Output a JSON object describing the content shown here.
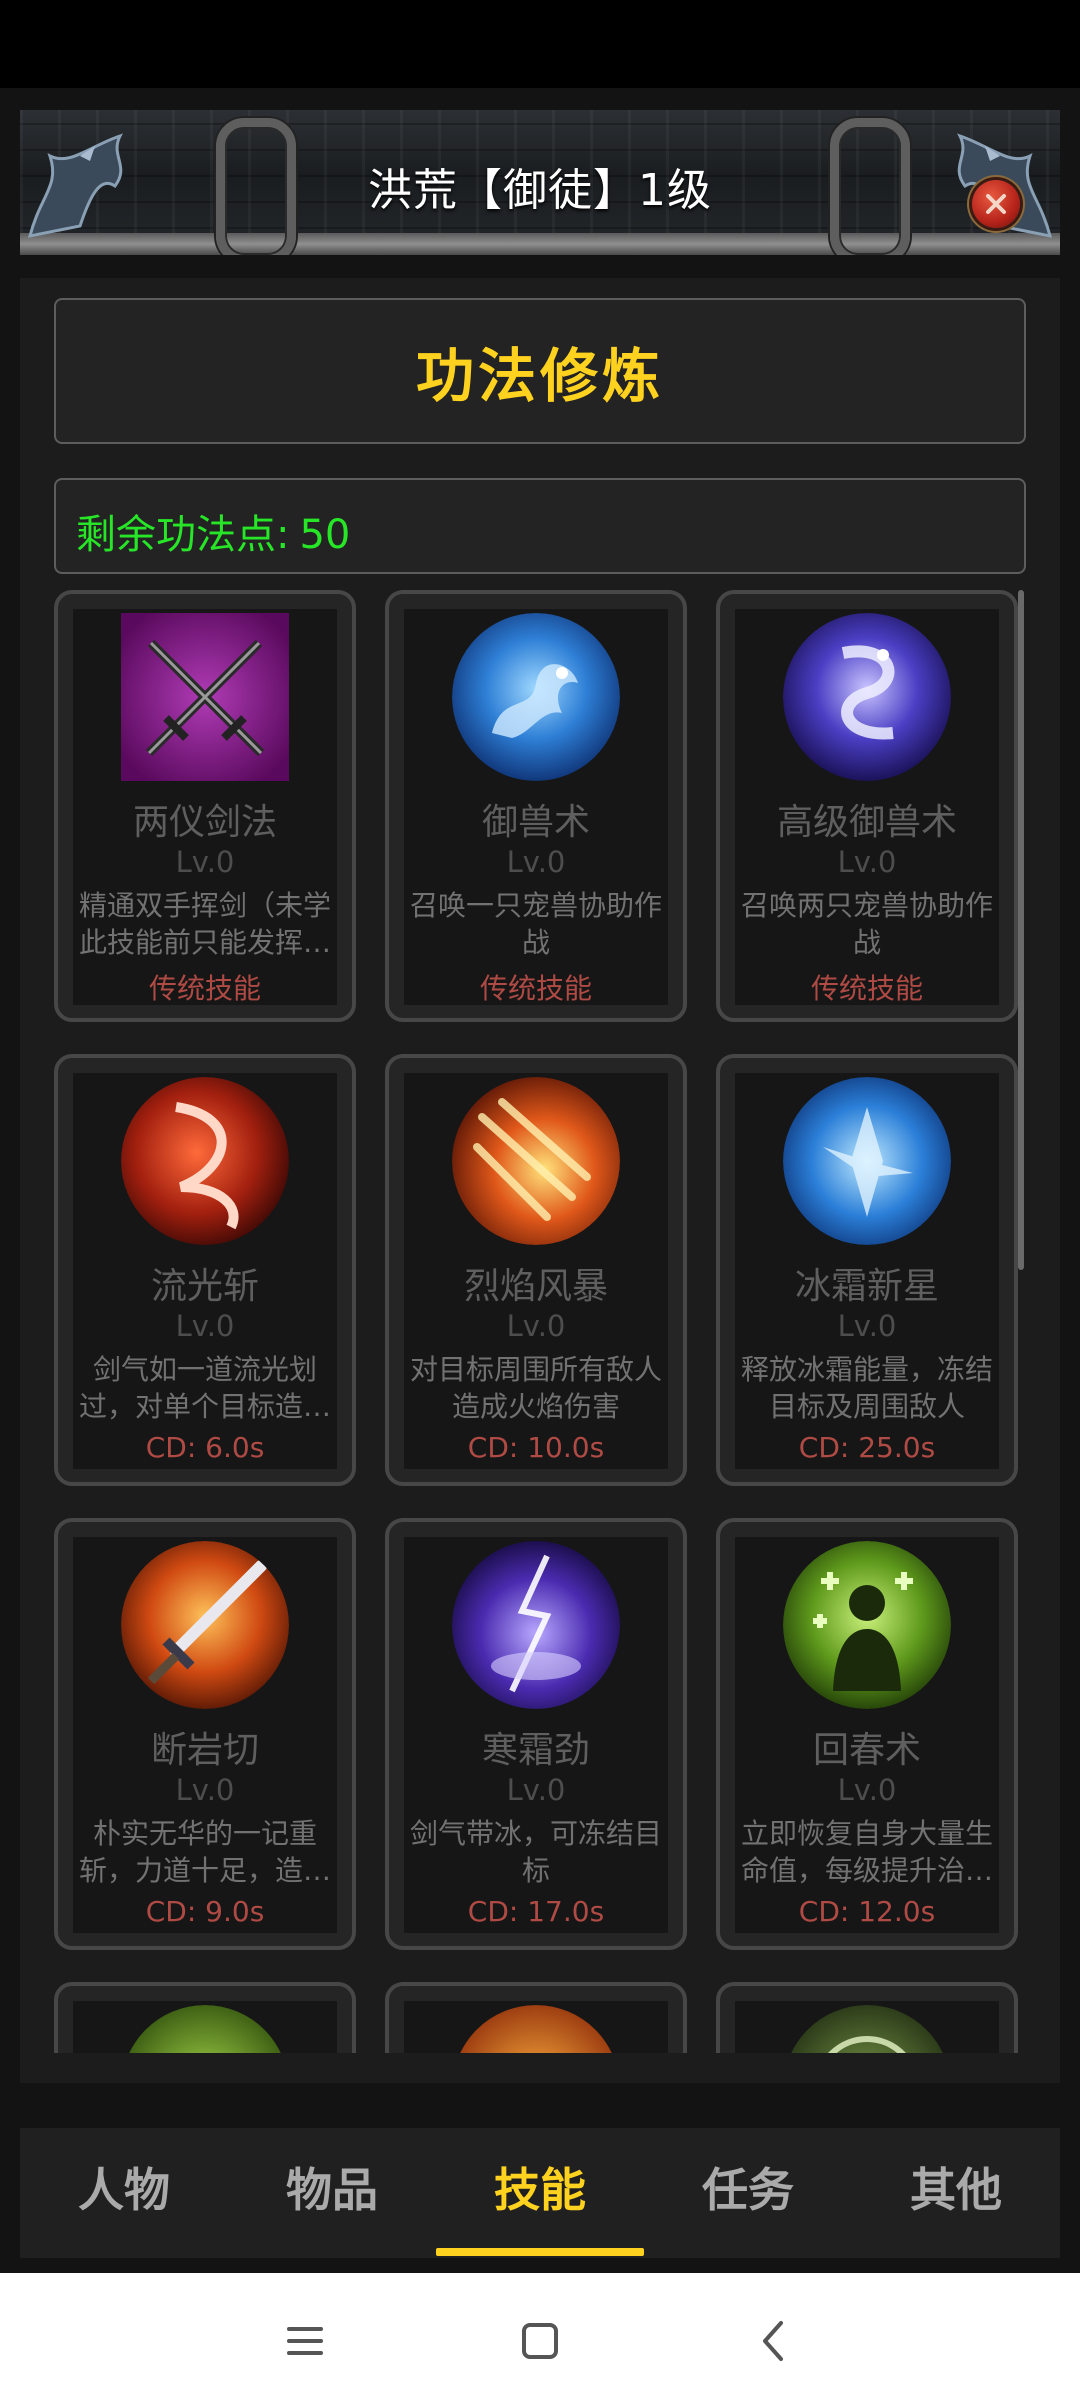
{
  "header": {
    "title": "洪荒【御徒】1级"
  },
  "panel": {
    "title": "功法修炼",
    "points_label": "剩余功法点:",
    "points_value": "50"
  },
  "skills": [
    {
      "name": "两仪剑法",
      "level": "Lv.0",
      "desc": "精通双手挥剑（未学此技能前只能发挥…",
      "tag": "传统技能",
      "icon": "crossed-swords-icon"
    },
    {
      "name": "御兽术",
      "level": "Lv.0",
      "desc": "召唤一只宠兽协助作战",
      "tag": "传统技能",
      "icon": "blue-dragon-icon"
    },
    {
      "name": "高级御兽术",
      "level": "Lv.0",
      "desc": "召唤两只宠兽协助作战",
      "tag": "传统技能",
      "icon": "purple-dragon-icon"
    },
    {
      "name": "流光斩",
      "level": "Lv.0",
      "desc": "剑气如一道流光划过，对单个目标造…",
      "tag": "CD: 6.0s",
      "icon": "light-slash-icon"
    },
    {
      "name": "烈焰风暴",
      "level": "Lv.0",
      "desc": "对目标周围所有敌人造成火焰伤害",
      "tag": "CD: 10.0s",
      "icon": "fire-storm-icon"
    },
    {
      "name": "冰霜新星",
      "level": "Lv.0",
      "desc": "释放冰霜能量，冻结目标及周围敌人",
      "tag": "CD: 25.0s",
      "icon": "frost-nova-icon"
    },
    {
      "name": "断岩切",
      "level": "Lv.0",
      "desc": "朴实无华的一记重斩，力道十足，造…",
      "tag": "CD: 9.0s",
      "icon": "flaming-sword-icon"
    },
    {
      "name": "寒霜劲",
      "level": "Lv.0",
      "desc": "剑气带冰，可冻结目标",
      "tag": "CD: 17.0s",
      "icon": "lightning-icon"
    },
    {
      "name": "回春术",
      "level": "Lv.0",
      "desc": "立即恢复自身大量生命值，每级提升治…",
      "tag": "CD: 12.0s",
      "icon": "heal-figure-icon"
    }
  ],
  "nav": {
    "tabs": [
      "人物",
      "物品",
      "技能",
      "任务",
      "其他"
    ],
    "active": "技能"
  },
  "colors": {
    "accent": "#ffd21f",
    "points": "#27e627",
    "tag": "#b04a44"
  }
}
